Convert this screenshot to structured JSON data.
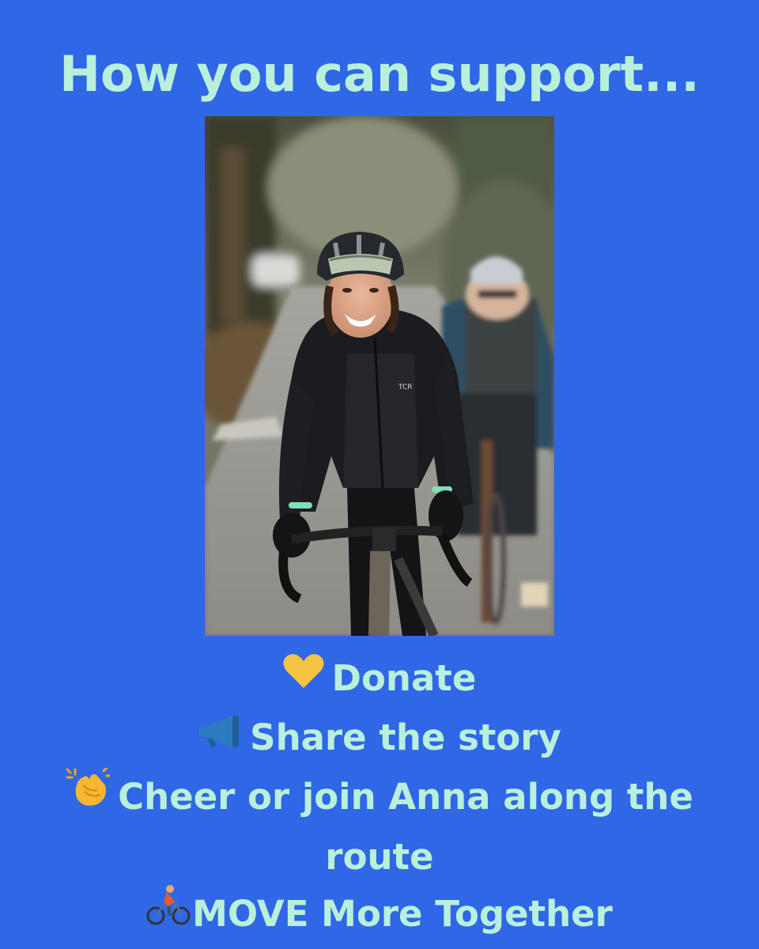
{
  "title": "How you can support...",
  "photo": {
    "jersey_text": "TCR"
  },
  "items": [
    {
      "icon": "yellow-heart-icon",
      "label": "Donate"
    },
    {
      "icon": "megaphone-icon",
      "label": "Share the story"
    },
    {
      "icon": "clapping-hands-icon",
      "label": "Cheer or join Anna along the",
      "label_cont": "route"
    },
    {
      "icon": "cyclist-icon",
      "label": "MOVE More Together"
    }
  ],
  "colors": {
    "background": "#2f67e6",
    "text": "#b9f0dc",
    "heart": "#f6c343",
    "megaphone": "#2c7bbf",
    "clap": "#f7b733"
  }
}
